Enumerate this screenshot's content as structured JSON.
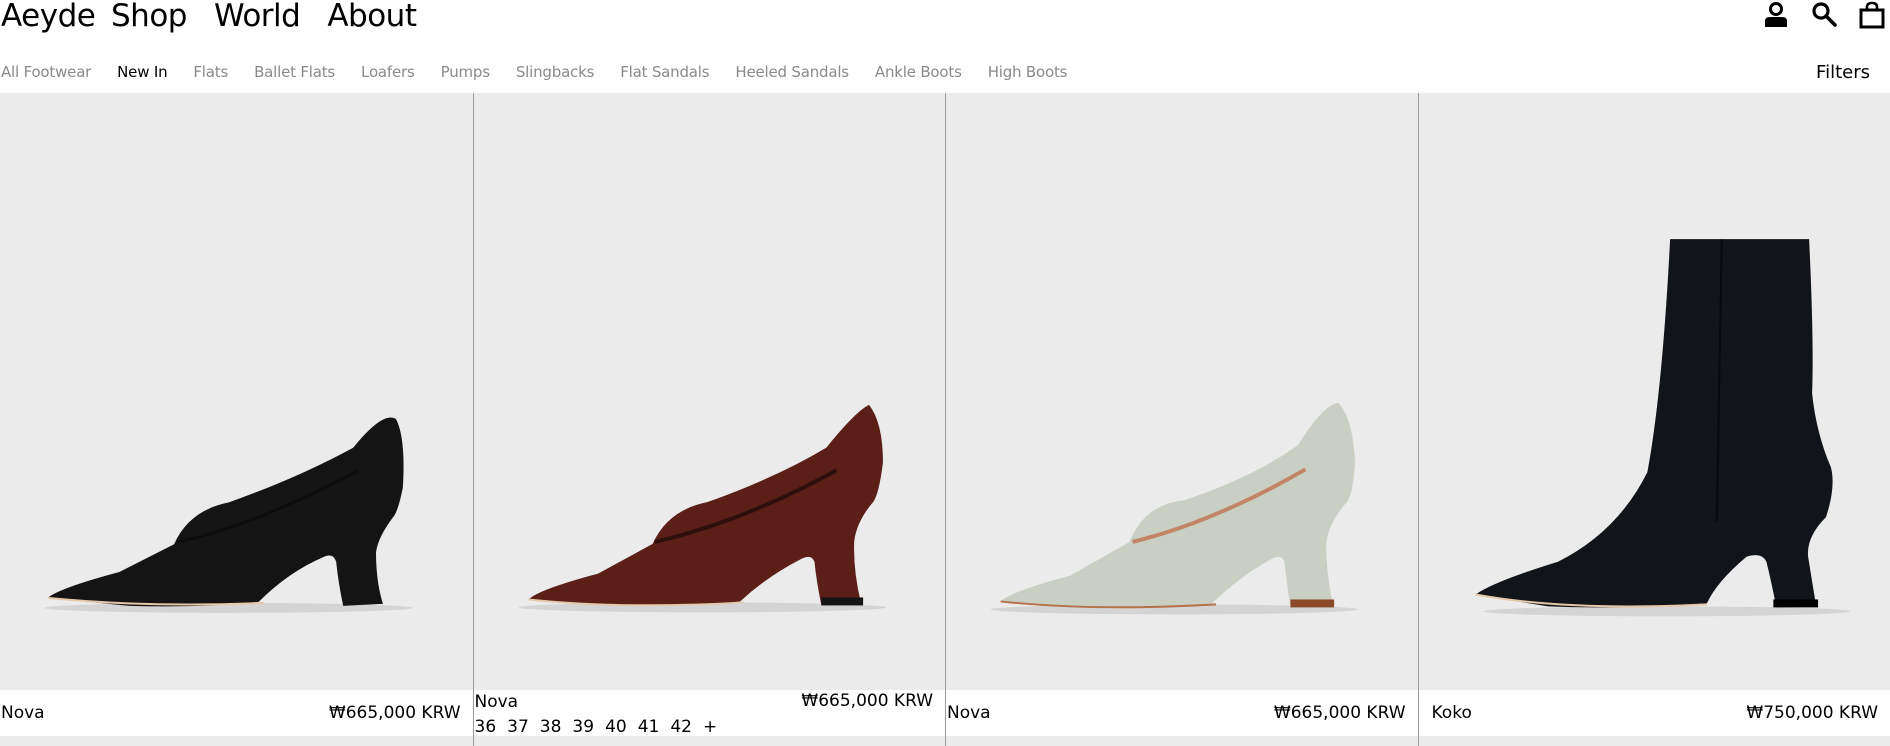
{
  "header": {
    "brand": "Aeyde",
    "links": [
      "Shop",
      "World",
      "About"
    ],
    "icons": [
      "account-icon",
      "search-icon",
      "bag-icon"
    ]
  },
  "categories": {
    "items": [
      "All Footwear",
      "New In",
      "Flats",
      "Ballet Flats",
      "Loafers",
      "Pumps",
      "Slingbacks",
      "Flat Sandals",
      "Heeled Sandals",
      "Ankle Boots",
      "High Boots"
    ],
    "active": "New In",
    "filters_label": "Filters"
  },
  "products": [
    {
      "name": "Nova",
      "price": "₩665,000 KRW",
      "color": "#141414"
    },
    {
      "name": "Nova",
      "price": "₩665,000 KRW",
      "color": "#5b1f18",
      "sizes": [
        "36",
        "37",
        "38",
        "39",
        "40",
        "41",
        "42",
        "+"
      ]
    },
    {
      "name": "Nova",
      "price": "₩665,000 KRW",
      "color": "#c9d0c3"
    },
    {
      "name": "Koko",
      "price": "₩750,000 KRW",
      "color": "#111418"
    }
  ]
}
